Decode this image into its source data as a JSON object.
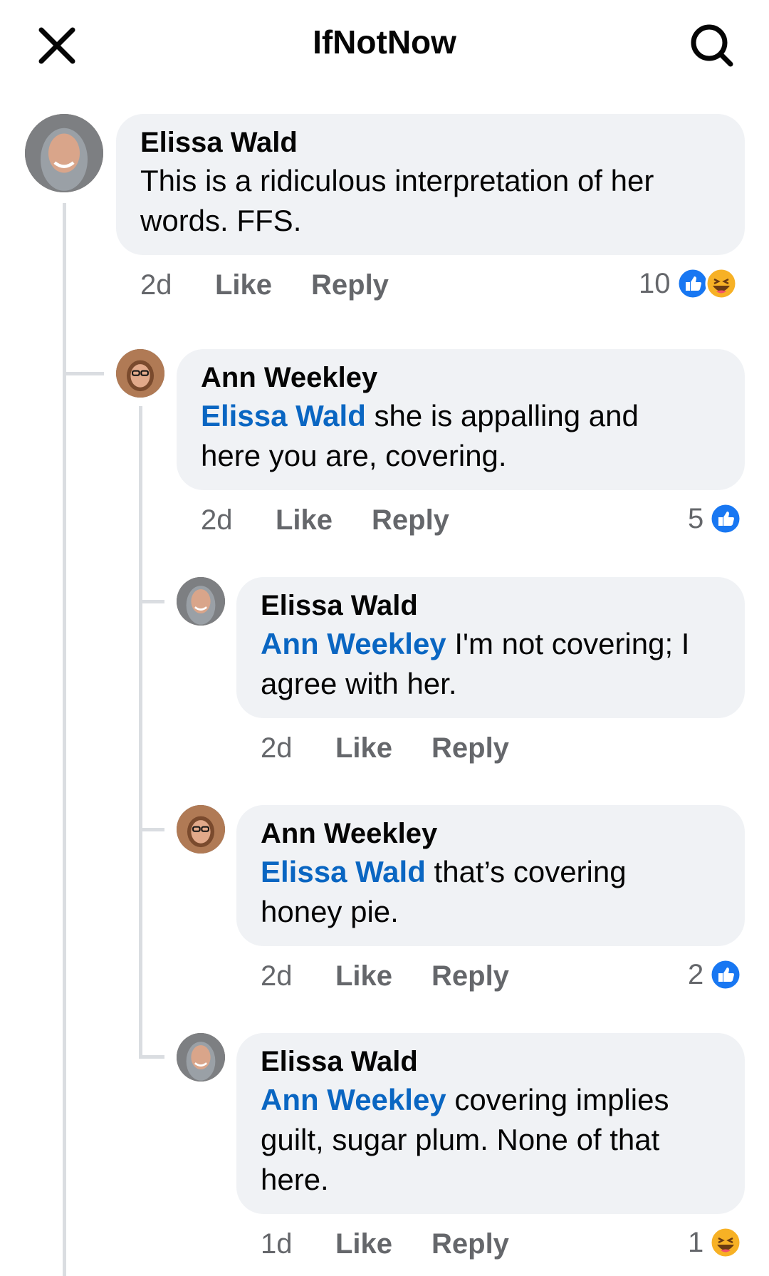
{
  "header": {
    "title": "IfNotNow",
    "close_icon": "close-icon",
    "search_icon": "search-icon"
  },
  "colors": {
    "mention": "#0a66c2",
    "bubble_bg": "#f0f2f5",
    "meta_text": "#65676b",
    "like_blue": "#1877f2",
    "haha_yellow": "#f7b125"
  },
  "comments": [
    {
      "author": "Elissa Wald",
      "mention": "",
      "lines": [
        "This is a ridiculous interpretation of her",
        "words. FFS."
      ],
      "time": "2d",
      "like_label": "Like",
      "reply_label": "Reply",
      "reaction_count": "10",
      "reactions": [
        "like",
        "haha"
      ]
    },
    {
      "author": "Ann Weekley",
      "mention": "Elissa Wald",
      "lines": [
        " she is appalling and",
        "here you are, covering."
      ],
      "time": "2d",
      "like_label": "Like",
      "reply_label": "Reply",
      "reaction_count": "5",
      "reactions": [
        "like"
      ]
    },
    {
      "author": "Elissa Wald",
      "mention": "Ann Weekley",
      "lines": [
        " I'm not covering; I",
        "agree with her."
      ],
      "time": "2d",
      "like_label": "Like",
      "reply_label": "Reply",
      "reaction_count": "",
      "reactions": []
    },
    {
      "author": "Ann Weekley",
      "mention": "Elissa Wald",
      "lines": [
        " that’s covering",
        "honey pie."
      ],
      "time": "2d",
      "like_label": "Like",
      "reply_label": "Reply",
      "reaction_count": "2",
      "reactions": [
        "like"
      ]
    },
    {
      "author": "Elissa Wald",
      "mention": "Ann Weekley",
      "lines": [
        " covering implies",
        "guilt, sugar plum. None of that",
        "here."
      ],
      "time": "1d",
      "like_label": "Like",
      "reply_label": "Reply",
      "reaction_count": "1",
      "reactions": [
        "haha"
      ]
    }
  ]
}
